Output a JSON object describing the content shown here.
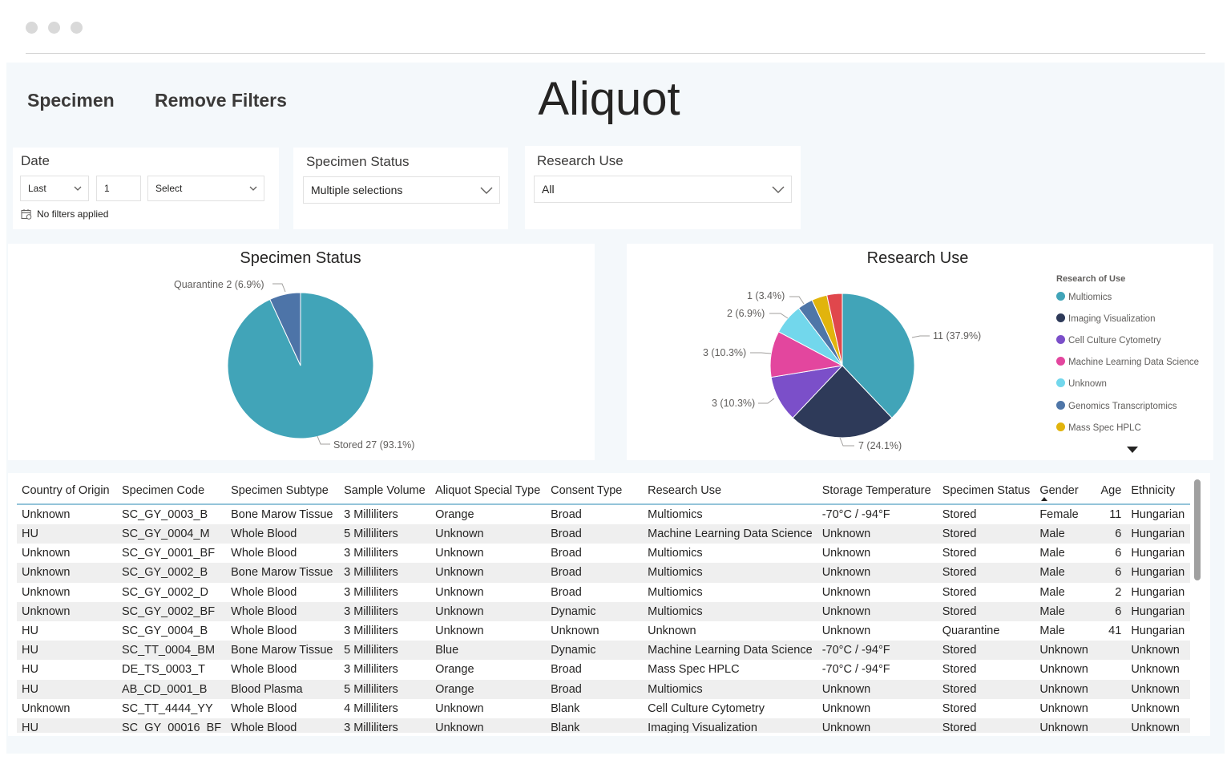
{
  "nav": {
    "specimen_label": "Specimen",
    "remove_filters_label": "Remove Filters"
  },
  "page_title": "Aliquot",
  "date_slicer": {
    "title": "Date",
    "period": "Last",
    "count": "1",
    "unit": "Select",
    "status": "No filters applied"
  },
  "specimen_status_slicer": {
    "title": "Specimen Status",
    "value": "Multiple selections"
  },
  "research_use_slicer": {
    "title": "Research Use",
    "value": "All"
  },
  "colors": {
    "teal": "#41A4B8",
    "navy": "#2E3A59",
    "purple": "#7B4FC9",
    "magenta": "#E3469E",
    "sky": "#72D7EC",
    "steel": "#4F76A8",
    "gold": "#E1B40D",
    "red": "#E0474C",
    "steel_dark": "#4D74A8"
  },
  "chart_data": [
    {
      "type": "pie",
      "title": "Specimen Status",
      "slices": [
        {
          "label": "Stored",
          "value": 27,
          "percent": 93.1,
          "color": "#41A4B8",
          "data_label": "Stored 27 (93.1%)"
        },
        {
          "label": "Quarantine",
          "value": 2,
          "percent": 6.9,
          "color": "#4D74A8",
          "data_label": "Quarantine 2 (6.9%)"
        }
      ]
    },
    {
      "type": "pie",
      "title": "Research Use",
      "legend_title": "Research of Use",
      "legend_position": "right",
      "slices": [
        {
          "label": "Multiomics",
          "value": 11,
          "percent": 37.9,
          "color": "#41A4B8",
          "data_label": "11 (37.9%)"
        },
        {
          "label": "Imaging Visualization",
          "value": 7,
          "percent": 24.1,
          "color": "#2E3A59",
          "data_label": "7 (24.1%)"
        },
        {
          "label": "Cell Culture Cytometry",
          "value": 3,
          "percent": 10.3,
          "color": "#7B4FC9",
          "data_label": "3 (10.3%)"
        },
        {
          "label": "Machine Learning Data Science",
          "value": 3,
          "percent": 10.3,
          "color": "#E3469E",
          "data_label": "3 (10.3%)"
        },
        {
          "label": "Unknown",
          "value": 2,
          "percent": 6.9,
          "color": "#72D7EC",
          "data_label": "2 (6.9%)"
        },
        {
          "label": "Genomics Transcriptomics",
          "value": 1,
          "percent": 3.4,
          "color": "#4F76A8",
          "data_label": "1 (3.4%)"
        },
        {
          "label": "Mass Spec HPLC",
          "value": 1,
          "percent": 3.4,
          "color": "#E1B40D",
          "data_label": ""
        },
        {
          "label": "",
          "value": 1,
          "percent": 3.4,
          "color": "#E0474C",
          "data_label": ""
        }
      ]
    }
  ],
  "table": {
    "columns": [
      "Country of Origin",
      "Specimen Code",
      "Specimen Subtype",
      "Sample Volume",
      "Aliquot Special Type",
      "Consent Type",
      "Research Use",
      "Storage Temperature",
      "Specimen Status",
      "Gender",
      "Age",
      "Ethnicity"
    ],
    "rows": [
      [
        "Unknown",
        "SC_GY_0003_B",
        "Bone Marow Tissue",
        "3 Milliliters",
        "Orange",
        "Broad",
        "Multiomics",
        "-70°C / -94°F",
        "Stored",
        "Female",
        "11",
        "Hungarian"
      ],
      [
        "HU",
        "SC_GY_0004_M",
        "Whole Blood",
        "5 Milliliters",
        "Unknown",
        "Broad",
        "Machine Learning Data Science",
        "Unknown",
        "Stored",
        "Male",
        "6",
        "Hungarian"
      ],
      [
        "Unknown",
        "SC_GY_0001_BF",
        "Whole Blood",
        "3 Milliliters",
        "Unknown",
        "Broad",
        "Multiomics",
        "Unknown",
        "Stored",
        "Male",
        "6",
        "Hungarian"
      ],
      [
        "Unknown",
        "SC_GY_0002_B",
        "Bone Marow Tissue",
        "3 Milliliters",
        "Unknown",
        "Broad",
        "Multiomics",
        "Unknown",
        "Stored",
        "Male",
        "6",
        "Hungarian"
      ],
      [
        "Unknown",
        "SC_GY_0002_D",
        "Whole Blood",
        "3 Milliliters",
        "Unknown",
        "Broad",
        "Multiomics",
        "Unknown",
        "Stored",
        "Male",
        "2",
        "Hungarian"
      ],
      [
        "Unknown",
        "SC_GY_0002_BF",
        "Whole Blood",
        "3 Milliliters",
        "Unknown",
        "Dynamic",
        "Multiomics",
        "Unknown",
        "Stored",
        "Male",
        "6",
        "Hungarian"
      ],
      [
        "HU",
        "SC_GY_0004_B",
        "Whole Blood",
        "3 Milliliters",
        "Unknown",
        "Unknown",
        "Unknown",
        "Unknown",
        "Quarantine",
        "Male",
        "41",
        "Hungarian"
      ],
      [
        "HU",
        "SC_TT_0004_BM",
        "Bone Marow Tissue",
        "5 Milliliters",
        "Blue",
        "Dynamic",
        "Machine Learning Data Science",
        "-70°C / -94°F",
        "Stored",
        "Unknown",
        "",
        "Unknown"
      ],
      [
        "HU",
        "DE_TS_0003_T",
        "Whole Blood",
        "3 Milliliters",
        "Orange",
        "Broad",
        "Mass Spec HPLC",
        "-70°C / -94°F",
        "Stored",
        "Unknown",
        "",
        "Unknown"
      ],
      [
        "HU",
        "AB_CD_0001_B",
        "Blood Plasma",
        "5 Milliliters",
        "Orange",
        "Broad",
        "Multiomics",
        "Unknown",
        "Stored",
        "Unknown",
        "",
        "Unknown"
      ],
      [
        "Unknown",
        "SC_TT_4444_YY",
        "Whole Blood",
        "4 Milliliters",
        "Unknown",
        "Blank",
        "Cell Culture Cytometry",
        "Unknown",
        "Stored",
        "Unknown",
        "",
        "Unknown"
      ],
      [
        "HU",
        "SC_GY_00016_BF",
        "Whole Blood",
        "3 Milliliters",
        "Unknown",
        "Blank",
        "Imaging Visualization",
        "Unknown",
        "Stored",
        "Unknown",
        "",
        "Unknown"
      ]
    ]
  }
}
